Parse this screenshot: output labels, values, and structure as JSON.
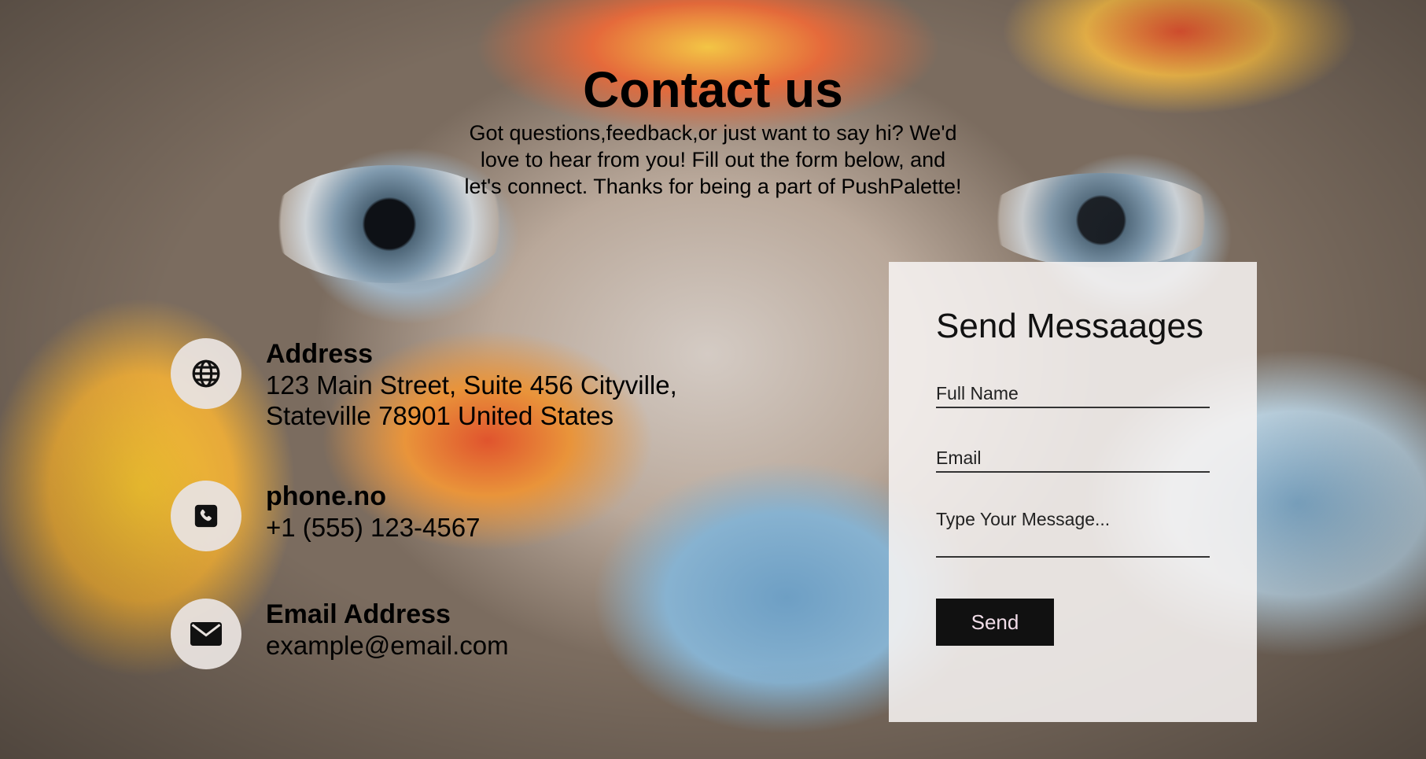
{
  "header": {
    "title": "Contact us",
    "subtitle": "Got questions,feedback,or just want to say hi? We'd love to hear from you! Fill out the form below, and let's connect. Thanks for being a part of PushPalette!"
  },
  "contact": [
    {
      "icon": "globe-icon",
      "title": "Address",
      "value": "123 Main Street, Suite 456 Cityville,\nStateville 78901 United States"
    },
    {
      "icon": "phone-icon",
      "title": "phone.no",
      "value": "+1 (555) 123-4567"
    },
    {
      "icon": "envelope-icon",
      "title": "Email Address",
      "value": "example@email.com"
    }
  ],
  "form": {
    "title": "Send Messaages",
    "full_name_placeholder": "Full Name",
    "email_placeholder": "Email",
    "message_placeholder": "Type Your Message...",
    "send_label": "Send"
  },
  "colors": {
    "card_bg": "#f6f3f1",
    "button_bg": "#111111",
    "button_text": "#f1dde8"
  }
}
